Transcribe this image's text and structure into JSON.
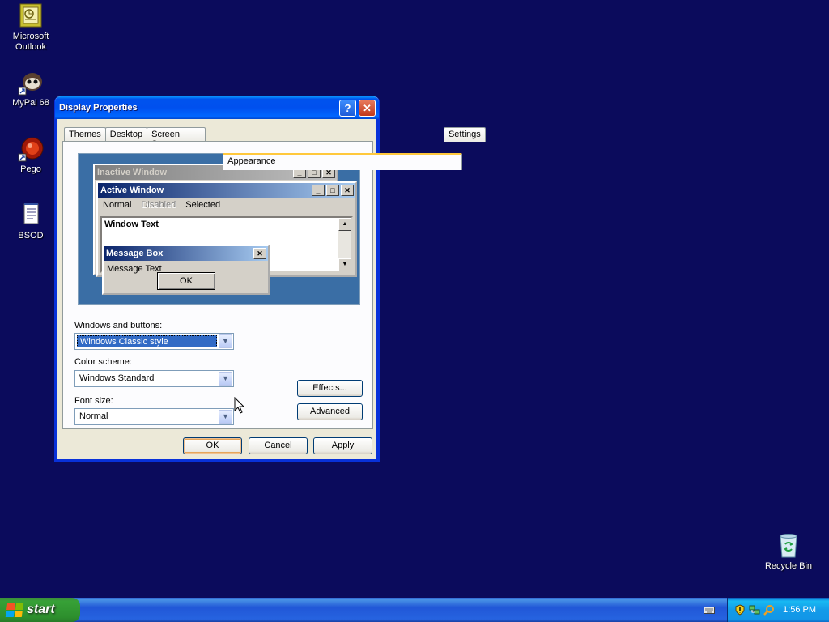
{
  "desktop": {
    "icons": [
      {
        "label_line1": "Microsoft",
        "label_line2": "Outlook",
        "icon": "outlook-icon"
      },
      {
        "label_line1": "MyPal 68",
        "label_line2": "",
        "icon": "mypal-icon"
      },
      {
        "label_line1": "Pego",
        "label_line2": "",
        "icon": "pego-icon"
      },
      {
        "label_line1": "BSOD",
        "label_line2": "",
        "icon": "notepad-document-icon"
      },
      {
        "label_line1": "Recycle Bin",
        "label_line2": "",
        "icon": "recycle-bin-icon"
      }
    ]
  },
  "dialog": {
    "title": "Display Properties",
    "help_glyph": "?",
    "close_glyph": "✕",
    "tabs": [
      "Themes",
      "Desktop",
      "Screen Saver",
      "Appearance",
      "Settings"
    ],
    "active_tab": "Appearance",
    "preview": {
      "inactive_title": "Inactive Window",
      "active_title": "Active Window",
      "menu_normal": "Normal",
      "menu_disabled": "Disabled",
      "menu_selected": "Selected",
      "window_text": "Window Text",
      "message_title": "Message Box",
      "message_text": "Message Text",
      "message_ok": "OK"
    },
    "windows_buttons_label": "Windows and buttons:",
    "windows_buttons_value": "Windows Classic style",
    "color_scheme_label": "Color scheme:",
    "color_scheme_value": "Windows Standard",
    "font_size_label": "Font size:",
    "font_size_value": "Normal",
    "effects_label": "Effects...",
    "advanced_label": "Advanced",
    "ok_label": "OK",
    "cancel_label": "Cancel",
    "apply_label": "Apply"
  },
  "taskbar": {
    "start_label": "start",
    "clock": "1:56 PM",
    "tray_icons": [
      "keyboard-icon",
      "security-shield-icon",
      "network-icon",
      "search-icon"
    ]
  },
  "colors": {
    "desktop_bg": "#0b0b5c",
    "dialog_face": "#ece9d8",
    "title_blue": "#0053ee",
    "preview_bg": "#3a6ea5"
  }
}
